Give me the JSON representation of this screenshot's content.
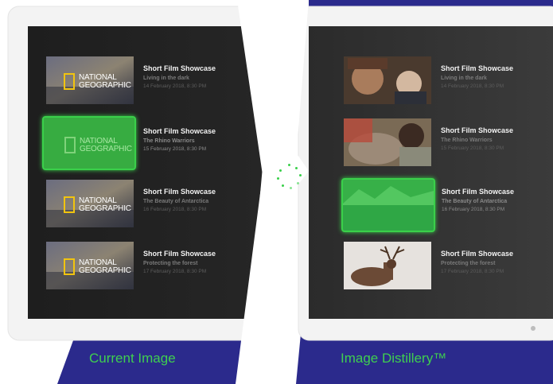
{
  "left_panel": {
    "caption": "Current Image",
    "items": [
      {
        "title": "Short Film Showcase",
        "subtitle": "Living in the dark",
        "date": "14 February 2018, 8:30 PM",
        "logo_line1": "NATIONAL",
        "logo_line2": "GEOGRAPHIC",
        "selected": false
      },
      {
        "title": "Short Film Showcase",
        "subtitle": "The Rhino Warriors",
        "date": "15 February 2018, 8:30 PM",
        "logo_line1": "NATIONAL",
        "logo_line2": "GEOGRAPHIC",
        "selected": true
      },
      {
        "title": "Short Film Showcase",
        "subtitle": "The Beauty of Antarctica",
        "date": "16 February 2018, 8:30 PM",
        "logo_line1": "NATIONAL",
        "logo_line2": "GEOGRAPHIC",
        "selected": false
      },
      {
        "title": "Short Film Showcase",
        "subtitle": "Protecting the forest",
        "date": "17 February 2018, 8:30 PM",
        "logo_line1": "NATIONAL",
        "logo_line2": "GEOGRAPHIC",
        "selected": false
      }
    ]
  },
  "right_panel": {
    "caption": "Image Distillery™",
    "items": [
      {
        "title": "Short Film Showcase",
        "subtitle": "Living in the dark",
        "date": "14 February 2018, 8:30 PM",
        "image": "children-photo",
        "selected": false
      },
      {
        "title": "Short Film Showcase",
        "subtitle": "The Rhino Warriors",
        "date": "15 February 2018, 8:30 PM",
        "image": "rhino-photo",
        "selected": false
      },
      {
        "title": "Short Film Showcase",
        "subtitle": "The Beauty of Antarctica",
        "date": "16 February 2018, 8:30 PM",
        "image": "antarctica-photo",
        "selected": true
      },
      {
        "title": "Short Film Showcase",
        "subtitle": "Protecting the forest",
        "date": "17 February 2018, 8:30 PM",
        "image": "deer-photo",
        "selected": false
      }
    ]
  },
  "colors": {
    "accent_green": "#3ad04a",
    "navy": "#2b2a8c",
    "screen_dark": "#212121",
    "bezel": "#f2f2f2",
    "logo_yellow": "#f1c40f"
  },
  "loading_icon": "spinner-icon"
}
